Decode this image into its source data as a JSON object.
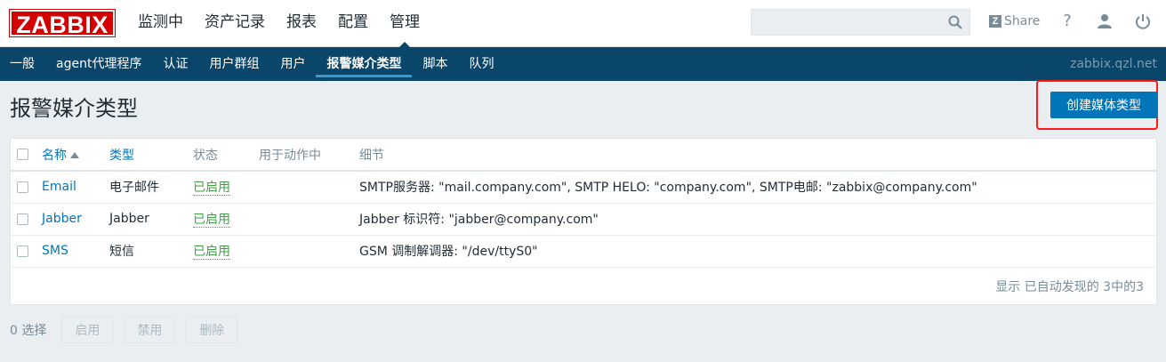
{
  "header": {
    "logo": "ZABBIX",
    "nav": [
      {
        "label": "监测中",
        "active": false
      },
      {
        "label": "资产记录",
        "active": false
      },
      {
        "label": "报表",
        "active": false
      },
      {
        "label": "配置",
        "active": false
      },
      {
        "label": "管理",
        "active": true
      }
    ],
    "search_value": "",
    "share_icon_letter": "Z",
    "share_label": "Share",
    "help_label": "?",
    "icons": [
      "search-icon",
      "user-icon",
      "power-icon"
    ]
  },
  "subnav": {
    "items": [
      {
        "label": "一般",
        "active": false
      },
      {
        "label": "agent代理程序",
        "active": false
      },
      {
        "label": "认证",
        "active": false
      },
      {
        "label": "用户群组",
        "active": false
      },
      {
        "label": "用户",
        "active": false
      },
      {
        "label": "报警媒介类型",
        "active": true
      },
      {
        "label": "脚本",
        "active": false
      },
      {
        "label": "队列",
        "active": false
      }
    ],
    "host": "zabbix.qzl.net"
  },
  "page": {
    "title": "报警媒介类型",
    "create_button": "创建媒体类型"
  },
  "table": {
    "columns": {
      "name": "名称",
      "type": "类型",
      "status": "状态",
      "used_in_actions": "用于动作中",
      "details": "细节"
    },
    "rows": [
      {
        "name": "Email",
        "type": "电子邮件",
        "status": "已启用",
        "used_in_actions": "",
        "details": "SMTP服务器: \"mail.company.com\", SMTP HELO: \"company.com\", SMTP电邮: \"zabbix@company.com\""
      },
      {
        "name": "Jabber",
        "type": "Jabber",
        "status": "已启用",
        "used_in_actions": "",
        "details": "Jabber 标识符: \"jabber@company.com\""
      },
      {
        "name": "SMS",
        "type": "短信",
        "status": "已启用",
        "used_in_actions": "",
        "details": "GSM 调制解调器: \"/dev/ttyS0\""
      }
    ],
    "footer": "显示 已自动发现的 3中的3"
  },
  "actions": {
    "selected": "0 选择",
    "enable": "启用",
    "disable": "禁用",
    "delete": "删除"
  },
  "colors": {
    "brand": "#d40000",
    "subnav_bg": "#0a466a",
    "primary": "#0275b8",
    "status_enabled": "#429e47",
    "highlight_box": "#ff1a1a"
  }
}
